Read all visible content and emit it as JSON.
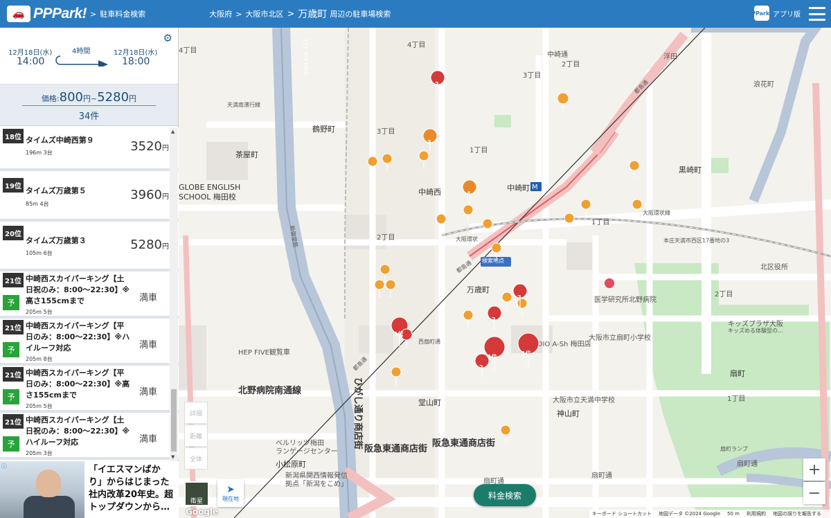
{
  "header": {
    "logo": "PPPark!",
    "crumb1": "駐車料金検索",
    "crumb_pref": "大阪府",
    "crumb_ward": "大阪市北区",
    "title": "万歳町",
    "title_sub": "周辺の駐車場検索",
    "app_label": "アプリ版",
    "app_icon_text": "PPark!"
  },
  "time": {
    "start_date": "12月18日(水)",
    "start_time": "14:00",
    "duration": "4時間",
    "end_date": "12月18日(水)",
    "end_time": "18:00"
  },
  "price": {
    "label": "価格:",
    "min": "800",
    "unit": "円",
    "sep": "~",
    "max": "5280",
    "unit2": "円",
    "count": "34件"
  },
  "items": [
    {
      "rank": "18位",
      "name": "タイムズ中崎西第９",
      "sub": "196m 3台",
      "price": "3520",
      "unit": "円"
    },
    {
      "rank": "19位",
      "name": "タイムズ万歳第５",
      "sub": "85m 4台",
      "price": "3960",
      "unit": "円"
    },
    {
      "rank": "20位",
      "name": "タイムズ万歳第３",
      "sub": "105m 6台",
      "price": "5280",
      "unit": "円"
    },
    {
      "rank": "21位",
      "name1": "中崎西スカイパーキング【土",
      "name2": "日祝のみ：8:00〜22:30】※",
      "name3": "高さ155cmまで",
      "sub": "205m 5台",
      "full": "満車",
      "reserve": "予"
    },
    {
      "rank": "21位",
      "name1": "中崎西スカイパーキング【平",
      "name2": "日のみ：8:00〜22:30】※ハ",
      "name3": "イルーフ対応",
      "sub": "205m 8台",
      "full": "満車",
      "reserve": "予"
    },
    {
      "rank": "21位",
      "name1": "中崎西スカイパーキング【平",
      "name2": "日のみ：8:00〜22:30】※高",
      "name3": "さ155cmまで",
      "sub": "205m 5台",
      "full": "満車",
      "reserve": "予"
    },
    {
      "rank": "21位",
      "name1": "中崎西スカイパーキング【土",
      "name2": "日祝のみ：8:00〜22:30】※",
      "name3": "ハイルーフ対応",
      "sub": "205m 3台",
      "full": "満車",
      "reserve": "予"
    }
  ],
  "ad": {
    "line1": "「イエスマンばか",
    "line2": "り」からはじまった",
    "line3": "社内改革20年史。超",
    "line4": "トップダウンから…"
  },
  "map": {
    "search_button": "料金検索",
    "search_point": "検索地点",
    "controls": [
      "詳細",
      "距離",
      "全体"
    ],
    "satellite": "衛星",
    "current_location": "現在地",
    "google": "Google",
    "attribution": [
      "キーボード ショートカット",
      "地図データ ©2024 Google",
      "50 m",
      "利用規約",
      "地図の誤りを報告する"
    ],
    "labels": {
      "nakazaki_nishi": "中崎西",
      "manzaicho": "万歳町",
      "nakazakicho": "中崎町",
      "kuroshakicho": "黒崎町",
      "tsurunocho": "鶴野町",
      "chayamachi": "茶屋町",
      "dozan": "堂山町",
      "kamiyama": "神山町",
      "ohgimachi": "扇町",
      "komatsubara": "小松原町",
      "higashi_dori": "ひがし通り商店街",
      "hankyu": "阪急東通商店街",
      "hankyu2": "阪急東通商店街",
      "kitanobyoin": "北野病院南通線",
      "globe": "GLOBE ENGLISH",
      "globe2": "SCHOOL 梅田校",
      "hepfive": "HEP FIVE観覧車",
      "hospital": "医学研究所北野病院",
      "school": "大阪市立扇町小学校",
      "jhs": "大阪市立天満中学校",
      "kids": "キッズプラザ大阪",
      "kids2": "キッズめる体験型の...",
      "studio": "STUDIO A-Sh 梅田店",
      "berlitz": "ベルリッツ梅田",
      "berlitz2": "ランゲージセンター",
      "shinbunsha": "新潟県関西情報発信",
      "shinbunsha2": "拠点「新潟をこめ」",
      "kitakuyakusho": "北区役所",
      "ohgimachi_kouen": "扇町",
      "nakazaki_dori": "中崎通",
      "ogimachi_dori": "扇町通",
      "ogimachi_dori2": "扇町通",
      "ohgimachi_ramp": "扇町ランプ",
      "honjo": "本庄天満市西区17番地の3",
      "oosaka_kanjo": "大阪環状",
      "oosaka_kanjo2": "大阪環状線",
      "shin_midosuji": "新御堂筋",
      "nat_rte": "Nat'l Rte 423",
      "umeda": "梅田",
      "toshimadori": "都島通",
      "toshimadori2": "都島通",
      "toshimadori3": "都島通",
      "nishi_ohgi": "西扇町通",
      "uki": "浮田",
      "namiwacho": "浪花町",
      "chome1": "1丁目",
      "chome2": "2丁目",
      "chome3": "3丁目",
      "chome4": "4丁目",
      "koshien": "天満南濱行線"
    },
    "pins": [
      {
        "label": "2",
        "kind": "red"
      },
      {
        "label": "3",
        "kind": "orange"
      },
      {
        "label": "4",
        "kind": "orange"
      },
      {
        "label": "2",
        "kind": "red"
      },
      {
        "label": "2",
        "kind": "red"
      },
      {
        "label": "1位",
        "kind": "red"
      },
      {
        "label": "1位",
        "kind": "red"
      },
      {
        "label": "1位",
        "kind": "red"
      },
      {
        "label": "2",
        "kind": "red"
      }
    ],
    "zoom_in": "+",
    "zoom_out": "−"
  },
  "colors": {
    "header_bg": "#2b7bc1",
    "pin_orange": "#f0a030",
    "pin_red": "#d43a3a",
    "search_btn": "#1c7c6b",
    "reserve": "#29a33a"
  }
}
